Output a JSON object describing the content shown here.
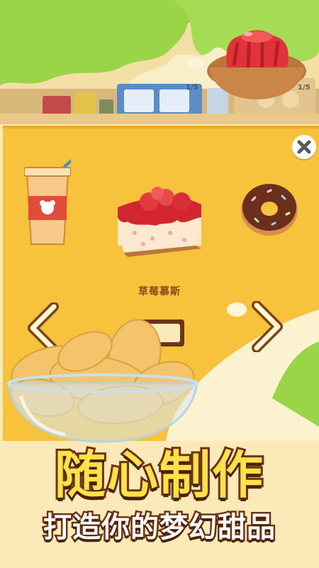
{
  "top_scene": {
    "price_tags": [
      "1/5",
      "1/5"
    ]
  },
  "panel": {
    "items": [
      {
        "icon": "drink-cup-icon"
      },
      {
        "icon": "strawberry-cake-icon"
      },
      {
        "icon": "donut-icon"
      }
    ],
    "selected_item_name": "草莓慕斯",
    "close_icon": "close-icon",
    "prev_icon": "chevron-left-icon",
    "next_icon": "chevron-right-icon"
  },
  "banner": {
    "title": "随心制作",
    "subtitle": "打造你的梦幻甜品"
  },
  "colors": {
    "panel_bg": "#f7c23c",
    "title_fill": "#ffe14a",
    "outline": "#6b3414",
    "item_name": "#8a4a1c"
  }
}
